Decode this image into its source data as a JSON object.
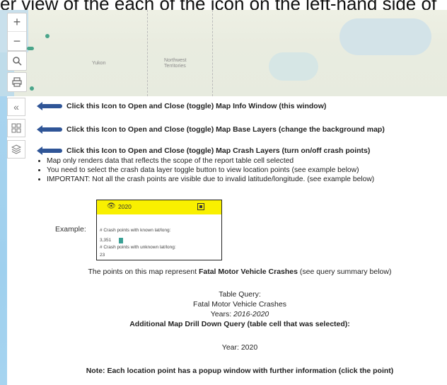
{
  "top_caption": "er view of the each of the icon on the left-hand side of",
  "map": {
    "labels": {
      "yukon": "Yukon",
      "nwt": "Northwest Territories"
    }
  },
  "toolbar": {
    "zoom_in": "+",
    "zoom_out": "−",
    "search": "⌕",
    "print": "⎙"
  },
  "side_buttons": {
    "info_toggle": "«",
    "base_layers": "▦",
    "crash_layers": "◈"
  },
  "info": {
    "lines": [
      "Click this Icon to Open and Close (toggle) Map Info Window (this window)",
      "Click this Icon to Open and Close (toggle) Map Base Layers (change the background map)",
      "Click this Icon to Open and Close (toggle) Map Crash Layers (turn on/off crash points)"
    ],
    "bullets": [
      "Map only renders data that reflects the scope of the report table cell selected",
      "You need to select the crash data layer toggle button to view location points (see example below)",
      "IMPORTANT: Not all the crash points are visible due to invalid latitude/longitude. (see example below)"
    ],
    "example_label": "Example:",
    "example": {
      "year": "2020",
      "known_label": "# Crash points with known lat/long:",
      "known_value": "3,351",
      "unknown_label": "# Crash points with unknown lat/long:",
      "unknown_value": "23"
    },
    "points_prefix": "The points on this map represent ",
    "points_bold": "Fatal Motor Vehicle Crashes",
    "points_suffix": " (see query summary below)",
    "table_query_title": "Table Query:",
    "table_query_name": "Fatal Motor Vehicle Crashes",
    "years_prefix": "Years: ",
    "years_value": "2016-2020",
    "drill_title": "Additional Map Drill Down Query (table cell that was selected):",
    "drill_year": "Year: 2020",
    "note": "Note: Each location point has a popup window with further information (click the point)"
  }
}
